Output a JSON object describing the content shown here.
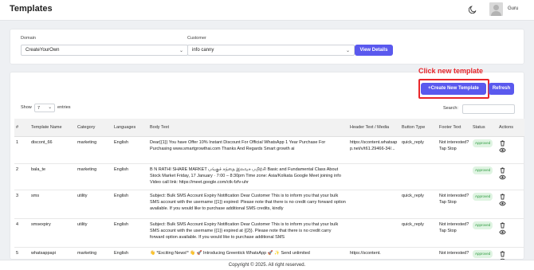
{
  "header": {
    "title": "Templates",
    "user_name": "Guru"
  },
  "filters": {
    "domain_label": "Domain",
    "domain_value": "CreateYourOwn",
    "customer_label": "Customer",
    "customer_value": "info canny",
    "view_details_label": "View Details"
  },
  "annotation": {
    "text": "Click new template"
  },
  "toolbar": {
    "create_label": "+Create New Template",
    "refresh_label": "Refresh"
  },
  "table_controls": {
    "show_label": "Show",
    "show_value": "7",
    "entries_label": "entries",
    "search_label": "Search:"
  },
  "columns": [
    "#",
    "Template Name",
    "Category",
    "Languages",
    "Body Text",
    "Header Text / Media",
    "Button Type",
    "Footer Text",
    "Status",
    "Actions"
  ],
  "rows": [
    {
      "num": "1",
      "name": "discont_66",
      "category": "marketing",
      "language": "English",
      "body": "Dear{{1}} You have Offer 10% Instant Discount For Official WhatsApp 1 Year Purchase For Purchasing www.smartgrowthai.com Thanks And Regards Smart growth ai",
      "header": "https://scontent.whatsapp.net/v/t61.29466-34/...",
      "button": "quick_reply",
      "footer": "Not interested? Tap Stop",
      "status": "Approved"
    },
    {
      "num": "2",
      "name": "bala_te",
      "category": "marketing",
      "language": "English",
      "body": "B N RATHI SHARE MARKET பங்குச் சந்தை இலவச பயிற்சி Basic and Fundamental Class About Stock Market Friday, 17 January · 7:00 – 8:30pm Time zone: Asia/Kolkata Google Meet joining info Video call link: https://meet.google.com/ctk-fzfv-uhr",
      "header": "",
      "button": "",
      "footer": "",
      "status": "Approved"
    },
    {
      "num": "3",
      "name": "sms",
      "category": "utility",
      "language": "English",
      "body": "Subject: Bulk SMS Account Expiry Notification Dear Customer This is to inform you that your bulk SMS account with the username {{1}} expired: Please note that there is no credit carry forward option available. If you would like to purchase additional SMS credits, kindly",
      "header": "",
      "button": "quick_reply",
      "footer": "Not interested? Tap Stop",
      "status": "Approved"
    },
    {
      "num": "4",
      "name": "smsexpiry",
      "category": "utility",
      "language": "English",
      "body": "Subject: Bulk SMS Account Expiry Notification Dear Customer This is to inform you that your bulk SMS account with the username {{1}} expired at {{2}}. Please note that there is no credit carry forward option available. If you would like to purchase additional SMS",
      "header": "",
      "button": "quick_reply",
      "footer": "Not interested? Tap Stop",
      "status": "Approved"
    },
    {
      "num": "5",
      "name": "whatsappapi",
      "category": "marketing",
      "language": "English",
      "body": "👋 *Exciting News!* 👋 🚀 Introducing Greentick WhatsApp 🚀 ✨ Send unlimited",
      "header": "https://scontent.",
      "button": "",
      "footer": "Not interested?",
      "status": "Approved"
    }
  ],
  "footer": {
    "text": "Copyright © 2025. All right reserved."
  }
}
